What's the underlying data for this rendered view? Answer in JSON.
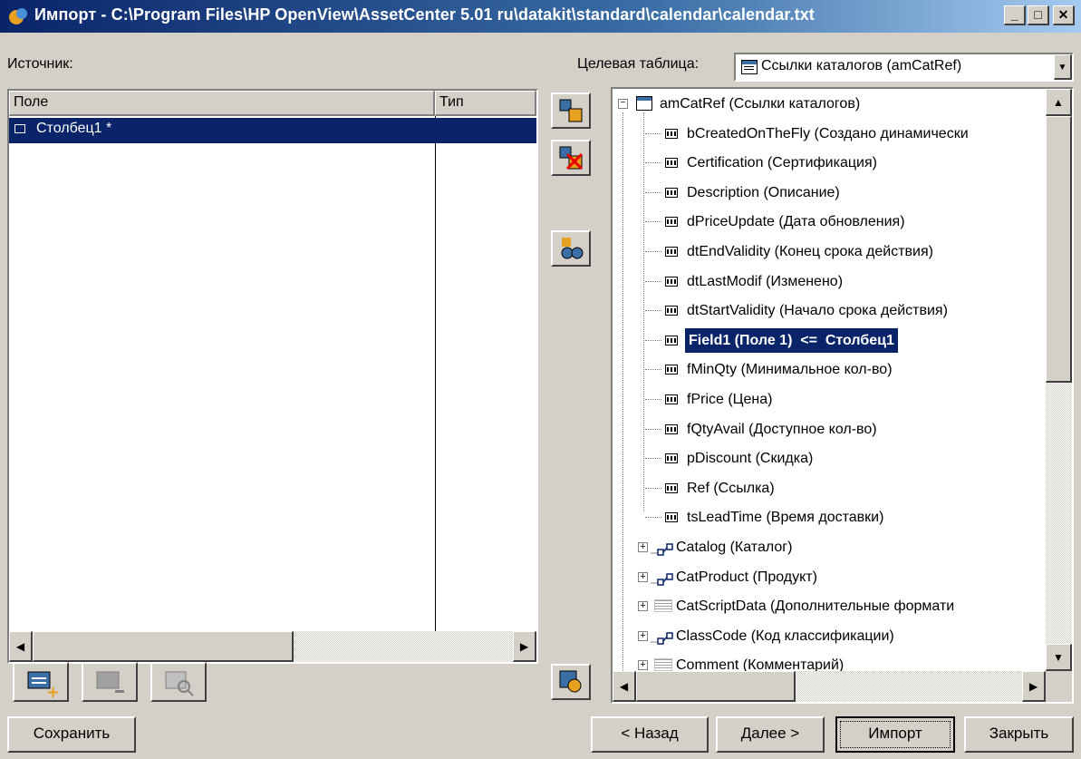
{
  "title": "Импорт - C:\\Program Files\\HP OpenView\\AssetCenter 5.01 ru\\datakit\\standard\\calendar\\calendar.txt",
  "source_label": "Источник:",
  "target_label": "Целевая таблица:",
  "target_value": "Ссылки каталогов (amCatRef)",
  "source_table": {
    "headers": [
      "Поле",
      "Тип"
    ],
    "rows": [
      {
        "field": "Столбец1 *",
        "type": ""
      }
    ]
  },
  "tree": {
    "root": "amCatRef (Ссылки каталогов)",
    "fields": [
      "bCreatedOnTheFly (Создано динамически",
      "Certification (Сертификация)",
      "Description (Описание)",
      "dPriceUpdate (Дата обновления)",
      "dtEndValidity (Конец срока действия)",
      "dtLastModif (Изменено)",
      "dtStartValidity (Начало срока действия)",
      "Field1 (Поле 1)  <=  Столбец1",
      "fMinQty (Минимальное кол-во)",
      "fPrice (Цена)",
      "fQtyAvail (Доступное кол-во)",
      "pDiscount (Скидка)",
      "Ref (Ссылка)",
      "tsLeadTime (Время доставки)"
    ],
    "links": [
      "Catalog (Каталог)",
      "CatProduct (Продукт)",
      "CatScriptData (Дополнительные формати",
      "ClassCode (Код классификации)",
      "Comment (Комментарий)"
    ]
  },
  "buttons": {
    "save": "Сохранить",
    "back": "< Назад",
    "next": "Далее >",
    "import": "Импорт",
    "close": "Закрыть"
  },
  "colors": {
    "selection": "#0a246a",
    "titlebar": "#0a246a",
    "face": "#d4d0c8"
  }
}
